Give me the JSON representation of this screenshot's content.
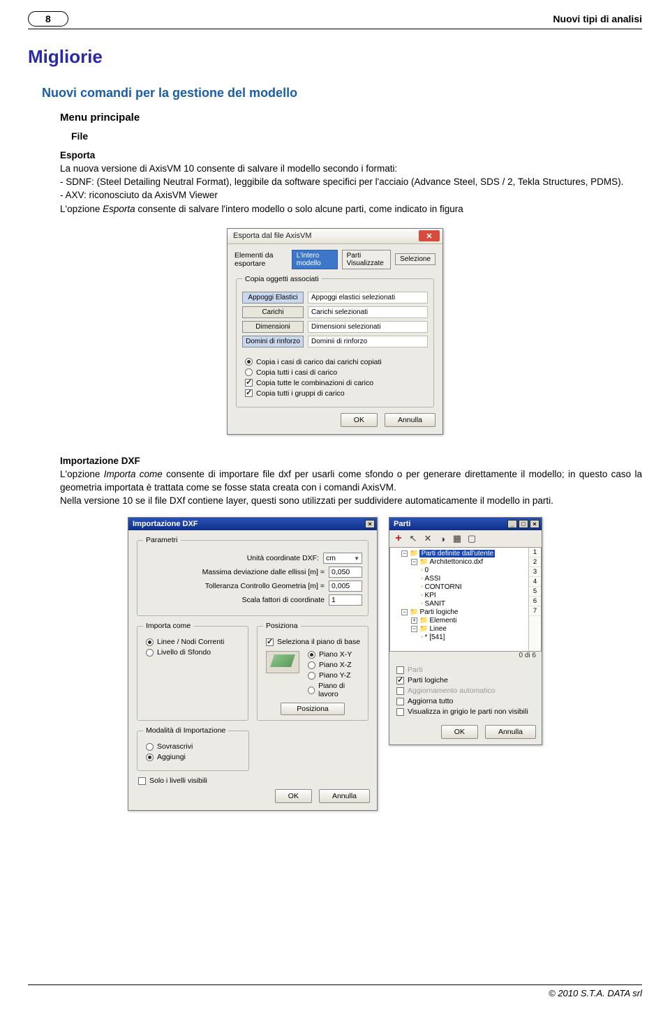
{
  "header": {
    "page_number": "8",
    "title": "Nuovi tipi di analisi"
  },
  "h1": "Migliorie",
  "h2": "Nuovi comandi per la gestione del modello",
  "h3_menu": "Menu principale",
  "h4_file": "File",
  "esporta": {
    "lead": "Esporta",
    "p1a": "La nuova versione di AxisVM 10  consente di salvare il modello  secondo i formati:",
    "li1": "- SDNF: (Steel Detailing Neutral Format), leggibile da software specifici per l'acciaio (Advance Steel, SDS / 2, Tekla Structures, PDMS).",
    "li2": "- AXV:  riconosciuto da AxisVM Viewer",
    "p2a": "L'opzione ",
    "p2em": "Esporta",
    "p2b": " consente di salvare l'intero modello o solo alcune parti, come indicato in figura"
  },
  "dlg_export": {
    "title": "Esporta dal file AxisVM",
    "elems_label": "Elementi da esportare",
    "tab_intero": "L'intero modello",
    "tab_parti": "Parti Visualizzate",
    "tab_sel": "Selezione",
    "fs_copia": "Copia oggetti associati",
    "rows": [
      {
        "btn": "Appoggi Elastici",
        "txt": "Appoggi elastici selezionati",
        "hl": true
      },
      {
        "btn": "Carichi",
        "txt": "Carichi selezionati",
        "hl": false
      },
      {
        "btn": "Dimensioni",
        "txt": "Dimensioni selezionati",
        "hl": false
      },
      {
        "btn": "Domini di rinforzo",
        "txt": "Dominii di rinforzo",
        "hl": true
      }
    ],
    "radio1": "Copia i casi di carico dai carichi copiati",
    "radio2": "Copia tutti i casi di carico",
    "check1": "Copia tutte le combinazioni di carico",
    "check2": "Copia tutti i gruppi di carico",
    "ok": "OK",
    "cancel": "Annulla"
  },
  "import": {
    "lead": "Importazione DXF",
    "p1a": "L'opzione ",
    "p1em": "Importa come",
    "p1b": " consente di importare file dxf per usarli come sfondo o per generare direttamente il modello; in questo caso la geometria importata è trattata come se fosse stata  creata con i comandi AxisVM.",
    "p2": "Nella versione 10 se il file DXf contiene layer, questi sono utilizzati per suddividere automaticamente il modello in parti."
  },
  "dlg_dxf": {
    "title": "Importazione DXF",
    "fs_param": "Parametri",
    "lbl_unit": "Unità coordinate DXF:",
    "val_unit": "cm",
    "lbl_dev": "Massima deviazione dalle ellissi [m] =",
    "val_dev": "0,050",
    "lbl_tol": "Tolleranza Controllo Geometria [m] =",
    "val_tol": "0,005",
    "lbl_scale": "Scala fattori di coordinate",
    "val_scale": "1",
    "fs_importa": "Importa come",
    "imp_r1": "Linee / Nodi Correnti",
    "imp_r2": "Livello di Sfondo",
    "fs_pos": "Posiziona",
    "pos_chk": "Seleziona il piano di base",
    "pos_r1": "Piano X-Y",
    "pos_r2": "Piano X-Z",
    "pos_r3": "Piano Y-Z",
    "pos_r4": "Piano di lavoro",
    "fs_mod": "Modalità di Importazione",
    "mod_r1": "Sovrascrivi",
    "mod_r2": "Aggiungi",
    "pos_btn": "Posiziona",
    "chk_vis": "Solo i livelli visibili",
    "ok": "OK",
    "cancel": "Annulla"
  },
  "dlg_parti": {
    "title": "Parti",
    "tree_root": "Parti definite dall'utente",
    "tree_items": [
      "Architettonico.dxf",
      "0",
      "ASSI",
      "CONTORNI",
      "KPI",
      "SANIT"
    ],
    "tree_logiche": "Parti logiche",
    "tree_elem": "Elementi",
    "tree_linee": "Linee",
    "tree_leaf": "* [541]",
    "nums": [
      "1",
      "2",
      "3",
      "4",
      "5",
      "6",
      "7"
    ],
    "count": "0 di 6",
    "opt1": "Parti",
    "opt2": "Parti logiche",
    "opt3": "Aggiornamento automatico",
    "opt4": "Aggiorna tutto",
    "opt5": "Visualizza in grigio le parti non visibili",
    "ok": "OK",
    "cancel": "Annulla"
  },
  "footer": "© 2010 S.T.A. DATA srl"
}
